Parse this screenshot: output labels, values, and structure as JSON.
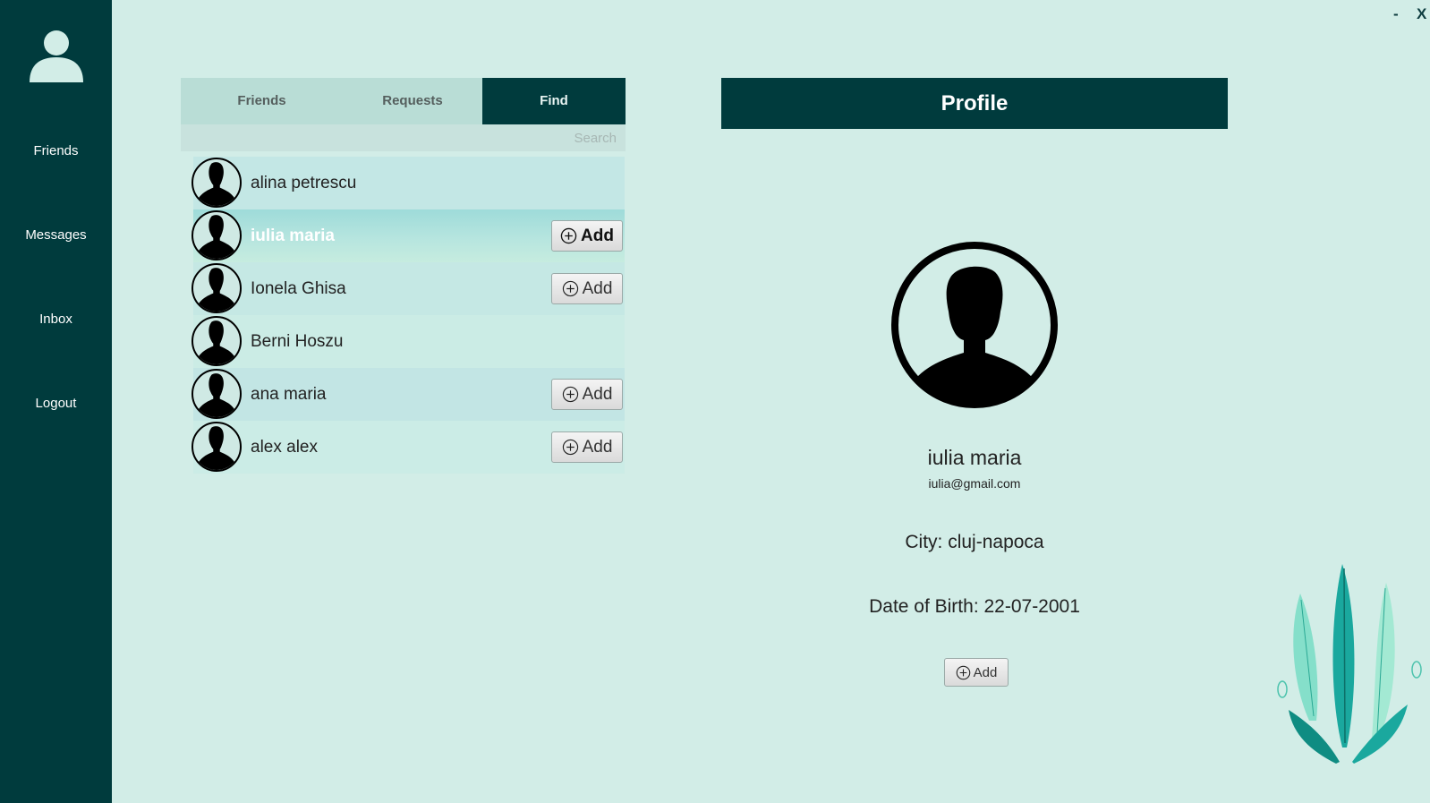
{
  "window": {
    "minimize_label": "-",
    "close_label": "X"
  },
  "sidebar": {
    "items": [
      {
        "label": "Friends"
      },
      {
        "label": "Messages"
      },
      {
        "label": "Inbox"
      },
      {
        "label": "Logout"
      }
    ]
  },
  "tabs": [
    {
      "label": "Friends",
      "active": false
    },
    {
      "label": "Requests",
      "active": false
    },
    {
      "label": "Find",
      "active": true
    }
  ],
  "search": {
    "placeholder": "Search",
    "value": ""
  },
  "users": [
    {
      "name": "alina petrescu",
      "add_label": ""
    },
    {
      "name": "iulia maria",
      "add_label": "Add",
      "selected": true
    },
    {
      "name": "Ionela Ghisa",
      "add_label": "Add"
    },
    {
      "name": "Berni Hoszu",
      "add_label": ""
    },
    {
      "name": "ana maria",
      "add_label": "Add"
    },
    {
      "name": "alex alex",
      "add_label": "Add"
    }
  ],
  "profile": {
    "header": "Profile",
    "name": "iulia maria",
    "email": "iulia@gmail.com",
    "city": "City: cluj-napoca",
    "dob": "Date of Birth: 22-07-2001",
    "add_label": "Add"
  },
  "colors": {
    "accent": "#003b3d",
    "background": "#d2ede7"
  }
}
